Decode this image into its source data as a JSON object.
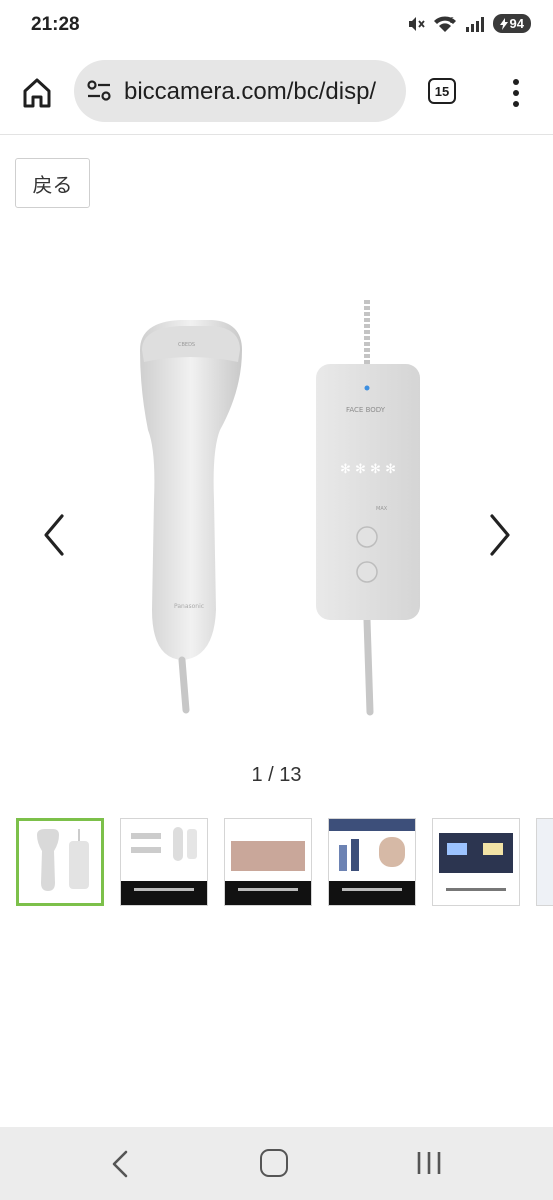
{
  "status_bar": {
    "time": "21:28",
    "signal_badge": "6",
    "battery": "94"
  },
  "browser": {
    "url": "biccamera.com/bc/disp/",
    "tab_count": "15"
  },
  "page": {
    "back_label": "戻る",
    "image_counter": "1 / 13"
  },
  "product_image": {
    "top_label": "CBEDS",
    "control_label": "FACE BODY",
    "bottom_label": "Panasonic",
    "mode_label": "MAX"
  },
  "thumbnails": [
    {
      "name": "thumbnail-1",
      "active": true
    },
    {
      "name": "thumbnail-2",
      "active": false
    },
    {
      "name": "thumbnail-3",
      "active": false
    },
    {
      "name": "thumbnail-4",
      "active": false
    },
    {
      "name": "thumbnail-5",
      "active": false
    },
    {
      "name": "thumbnail-6",
      "active": false
    }
  ],
  "colors": {
    "active_thumb_border": "#7cc04a",
    "omnibox_bg": "#e6e6e6",
    "nav_bg": "#ececec"
  }
}
